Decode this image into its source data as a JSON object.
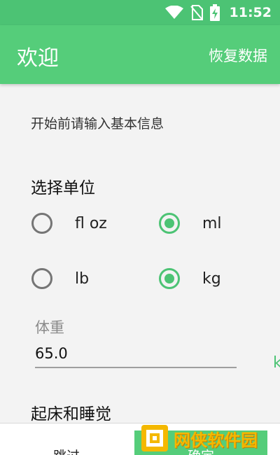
{
  "status_bar": {
    "time": "11:52",
    "icons": [
      "wifi-icon",
      "no-sim-icon",
      "battery-charging-icon"
    ]
  },
  "app_bar": {
    "title": "欢迎",
    "restore_label": "恢复数据"
  },
  "content": {
    "intro": "开始前请输入基本信息",
    "units_title": "选择单位",
    "units": {
      "volume": {
        "options": [
          {
            "label": "fl oz",
            "checked": false
          },
          {
            "label": "ml",
            "checked": true
          }
        ]
      },
      "weight": {
        "options": [
          {
            "label": "lb",
            "checked": false
          },
          {
            "label": "kg",
            "checked": true
          }
        ]
      }
    },
    "weight_field": {
      "label": "体重",
      "value": "65.0",
      "unit": "k"
    },
    "next_section_title": "起床和睡觉"
  },
  "bottom_bar": {
    "skip_label": "跳过",
    "confirm_label": "确定"
  },
  "watermark": {
    "text": "网侠软件园"
  },
  "colors": {
    "primary": "#55cd7a",
    "status_bar": "#4cc374",
    "accent": "#4cc374"
  }
}
